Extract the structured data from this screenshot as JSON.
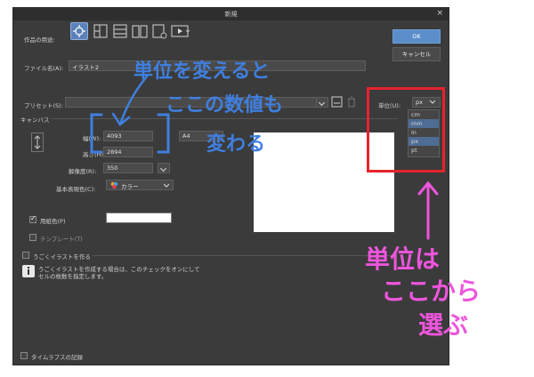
{
  "window": {
    "title": "新規",
    "close_glyph": "×"
  },
  "purpose": {
    "label": "作品の用途:",
    "icons": [
      "illust-icon",
      "comic-icon",
      "web-comic-icon",
      "book-icon",
      "bookbinding-icon",
      "animation-icon"
    ]
  },
  "buttons": {
    "ok": "OK",
    "cancel": "キャンセル"
  },
  "file_name": {
    "label": "ファイル名(A):",
    "value": "イラスト2"
  },
  "preset": {
    "label": "プリセット(S):",
    "value": ""
  },
  "unit": {
    "label": "単位(U):",
    "selected": "px",
    "options": [
      "cm",
      "mm",
      "in",
      "px",
      "pt"
    ],
    "highlighted": "mm"
  },
  "canvas": {
    "section": "キャンバス",
    "width_label": "幅(W):",
    "width_value": "4093",
    "height_label": "高さ(H):",
    "height_value": "2894",
    "preset_size": "A4",
    "resolution_label": "解像度(R):",
    "resolution_value": "350",
    "color_label": "基本表現色(C):",
    "color_value": "カラー"
  },
  "paper": {
    "label": "用紙色(P)",
    "checked": true,
    "color": "#ffffff"
  },
  "template": {
    "label": "テンプレート(T)",
    "checked": false
  },
  "anim": {
    "label": "うごくイラストを作る",
    "info_line1": "うごくイラストを作成する場合は、このチェックをオンにして",
    "info_line2": "セルの枚数を指定します。"
  },
  "timelapse": {
    "label": "タイムラプスの記録"
  },
  "annotations": {
    "blue_line1": "単位を変えると",
    "blue_line2": "ここの数値も",
    "blue_line3": "変わる",
    "pink_line1": "単位は",
    "pink_line2": "ここから",
    "pink_line3": "選ぶ",
    "blue_color": "#3f7fe0",
    "pink_color": "#ee55dd",
    "box_color": "#e8222e"
  }
}
